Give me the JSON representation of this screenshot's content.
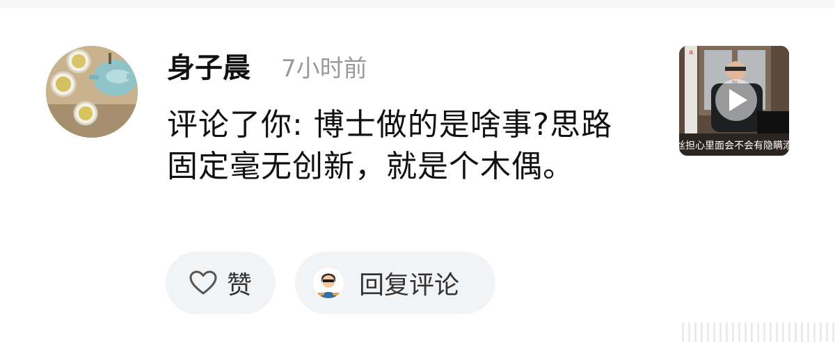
{
  "notification": {
    "username": "身子晨",
    "time": "7小时前",
    "comment": "评论了你: 博士做的是啥事?思路固定毫无创新，就是个木偶。"
  },
  "thumbnail": {
    "icon": "play-icon",
    "caption": "粉丝担心里面会不会有隐瞒添加"
  },
  "actions": {
    "like_label": "赞",
    "like_icon": "heart-outline-icon",
    "reply_label": "回复评论"
  },
  "colors": {
    "background": "#ffffff",
    "button_bg": "#f2f3f5",
    "time_text": "#9a9a9a",
    "primary_text": "#111111"
  }
}
